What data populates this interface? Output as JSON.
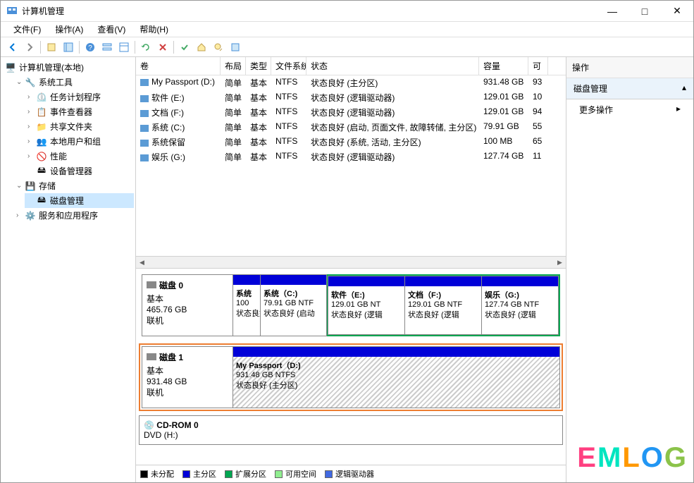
{
  "window": {
    "title": "计算机管理",
    "min": "—",
    "max": "□",
    "close": "✕"
  },
  "menubar": {
    "file": "文件(F)",
    "action": "操作(A)",
    "view": "查看(V)",
    "help": "帮助(H)"
  },
  "tree": {
    "root": "计算机管理(本地)",
    "sys_tools": "系统工具",
    "task_scheduler": "任务计划程序",
    "event_viewer": "事件查看器",
    "shared_folders": "共享文件夹",
    "local_users": "本地用户和组",
    "performance": "性能",
    "device_manager": "设备管理器",
    "storage": "存储",
    "disk_mgmt": "磁盘管理",
    "services": "服务和应用程序"
  },
  "vol_header": {
    "vol": "卷",
    "layout": "布局",
    "type": "类型",
    "fs": "文件系统",
    "status": "状态",
    "cap": "容量",
    "free": "可"
  },
  "volumes": [
    {
      "name": "My Passport (D:)",
      "layout": "简单",
      "type": "基本",
      "fs": "NTFS",
      "status": "状态良好 (主分区)",
      "cap": "931.48 GB",
      "free": "93"
    },
    {
      "name": "软件 (E:)",
      "layout": "简单",
      "type": "基本",
      "fs": "NTFS",
      "status": "状态良好 (逻辑驱动器)",
      "cap": "129.01 GB",
      "free": "10"
    },
    {
      "name": "文档 (F:)",
      "layout": "简单",
      "type": "基本",
      "fs": "NTFS",
      "status": "状态良好 (逻辑驱动器)",
      "cap": "129.01 GB",
      "free": "94"
    },
    {
      "name": "系统 (C:)",
      "layout": "简单",
      "type": "基本",
      "fs": "NTFS",
      "status": "状态良好 (启动, 页面文件, 故障转储, 主分区)",
      "cap": "79.91 GB",
      "free": "55"
    },
    {
      "name": "系统保留",
      "layout": "简单",
      "type": "基本",
      "fs": "NTFS",
      "status": "状态良好 (系统, 活动, 主分区)",
      "cap": "100 MB",
      "free": "65"
    },
    {
      "name": "娱乐 (G:)",
      "layout": "简单",
      "type": "基本",
      "fs": "NTFS",
      "status": "状态良好 (逻辑驱动器)",
      "cap": "127.74 GB",
      "free": "11"
    }
  ],
  "disk0": {
    "name": "磁盘 0",
    "type": "基本",
    "size": "465.76 GB",
    "status": "联机",
    "parts": [
      {
        "name": "系统",
        "size": "100",
        "status": "状态良好"
      },
      {
        "name": "系统（C:)",
        "size": "79.91 GB NTF",
        "status": "状态良好 (启动"
      },
      {
        "name": "软件（E:)",
        "size": "129.01 GB NT",
        "status": "状态良好 (逻辑"
      },
      {
        "name": "文档（F:)",
        "size": "129.01 GB NTF",
        "status": "状态良好 (逻辑"
      },
      {
        "name": "娱乐（G:)",
        "size": "127.74 GB NTF",
        "status": "状态良好 (逻辑"
      }
    ]
  },
  "disk1": {
    "name": "磁盘 1",
    "type": "基本",
    "size": "931.48 GB",
    "status": "联机",
    "parts": [
      {
        "name": "My Passport（D:)",
        "size": "931.48 GB NTFS",
        "status": "状态良好 (主分区)"
      }
    ]
  },
  "cdrom": {
    "name": "CD-ROM 0",
    "drive": "DVD (H:)"
  },
  "legend": {
    "unalloc": "未分配",
    "primary": "主分区",
    "extended": "扩展分区",
    "freespace": "可用空间",
    "logical": "逻辑驱动器"
  },
  "right": {
    "header": "操作",
    "section": "磁盘管理",
    "more": "更多操作"
  },
  "watermark": "EMLOG"
}
